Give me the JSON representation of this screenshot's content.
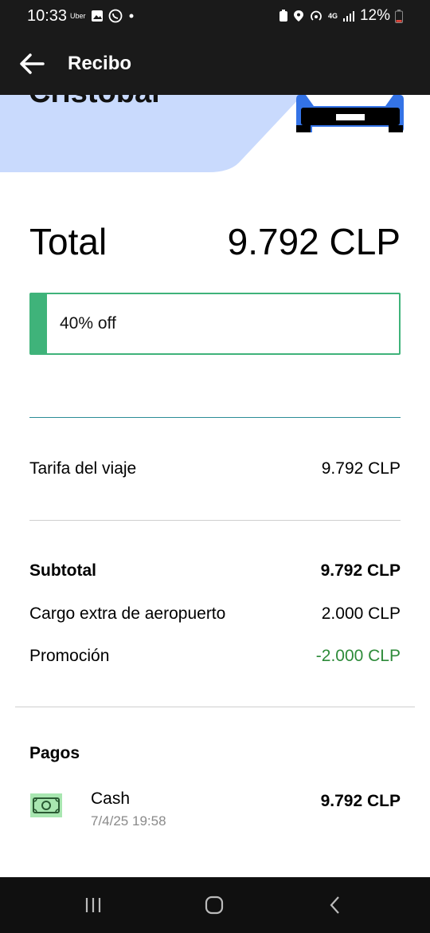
{
  "status_bar": {
    "time": "10:33",
    "app_tag": "Uber",
    "network": "4G",
    "battery": "12%"
  },
  "app_bar": {
    "title": "Recibo",
    "back_icon": "arrow-left-icon"
  },
  "header": {
    "driver_name": "Cristobal",
    "colors": {
      "hero_bg": "#c9dafd",
      "car": "#3473e6"
    }
  },
  "total": {
    "label": "Total",
    "value": "9.792 CLP"
  },
  "promo": {
    "text": "40% off",
    "accent": "#3fb37a"
  },
  "fare": {
    "label": "Tarifa del viaje",
    "value": "9.792 CLP"
  },
  "breakdown": [
    {
      "label": "Subtotal",
      "value": "9.792 CLP"
    },
    {
      "label": "Cargo extra de aeropuerto",
      "value": "2.000 CLP"
    },
    {
      "label": "Promoción",
      "value": "-2.000 CLP"
    }
  ],
  "payments": {
    "title": "Pagos",
    "method": "Cash",
    "date": "7/4/25 19:58",
    "amount": "9.792 CLP",
    "icon": "cash-icon"
  },
  "nav_bar": {
    "icons": [
      "recent-apps-icon",
      "home-icon",
      "back-icon"
    ]
  }
}
